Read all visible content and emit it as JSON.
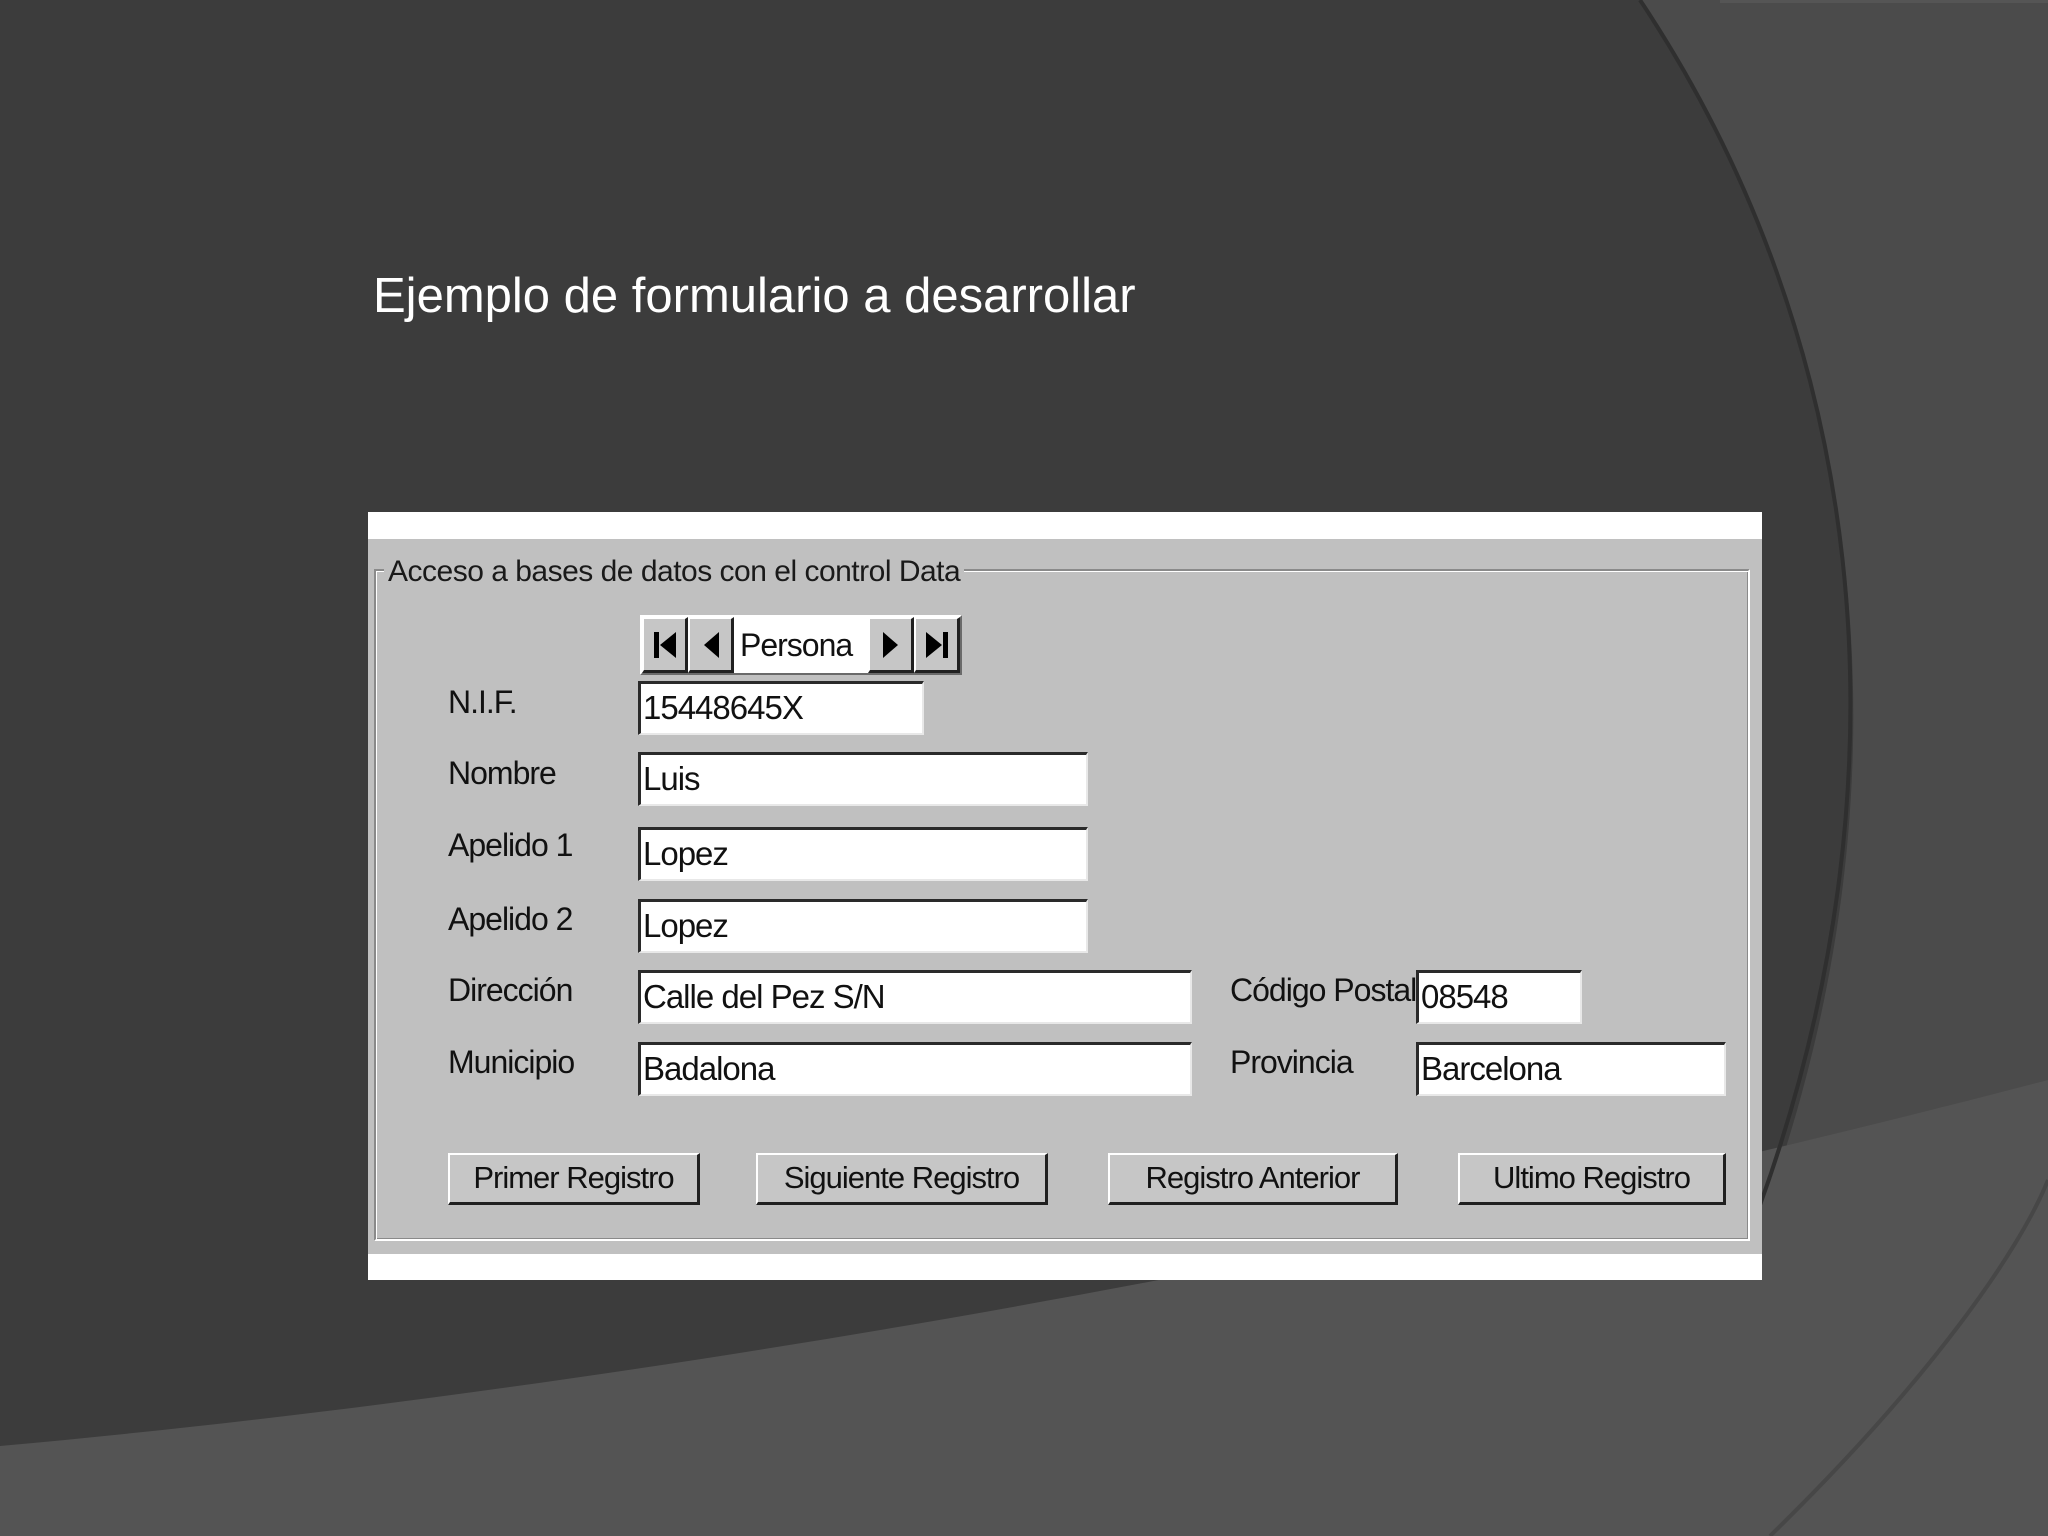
{
  "slide": {
    "title": "Ejemplo de formulario a desarrollar"
  },
  "form": {
    "group_title": "Acceso a bases de datos con el control Data",
    "data_control": {
      "caption": "Persona",
      "icons": [
        "first-record-icon",
        "previous-record-icon",
        "next-record-icon",
        "last-record-icon"
      ]
    },
    "fields": {
      "nif": {
        "label": "N.I.F.",
        "value": "15448645X"
      },
      "nombre": {
        "label": "Nombre",
        "value": "Luis"
      },
      "apellido1": {
        "label": "Apelido 1",
        "value": "Lopez"
      },
      "apellido2": {
        "label": "Apelido 2",
        "value": "Lopez"
      },
      "direccion": {
        "label": "Dirección",
        "value": "Calle del Pez S/N"
      },
      "codigo_postal": {
        "label": "Código Postal",
        "value": "08548"
      },
      "municipio": {
        "label": "Municipio",
        "value": "Badalona"
      },
      "provincia": {
        "label": "Provincia",
        "value": "Barcelona"
      }
    },
    "buttons": {
      "first": "Primer Registro",
      "next": "Siguiente Registro",
      "previous": "Registro Anterior",
      "last": "Ultimo Registro"
    }
  },
  "colors": {
    "background": "#3d3d3d",
    "form_face": "#c0c0c0",
    "title_text": "#ffffff"
  }
}
